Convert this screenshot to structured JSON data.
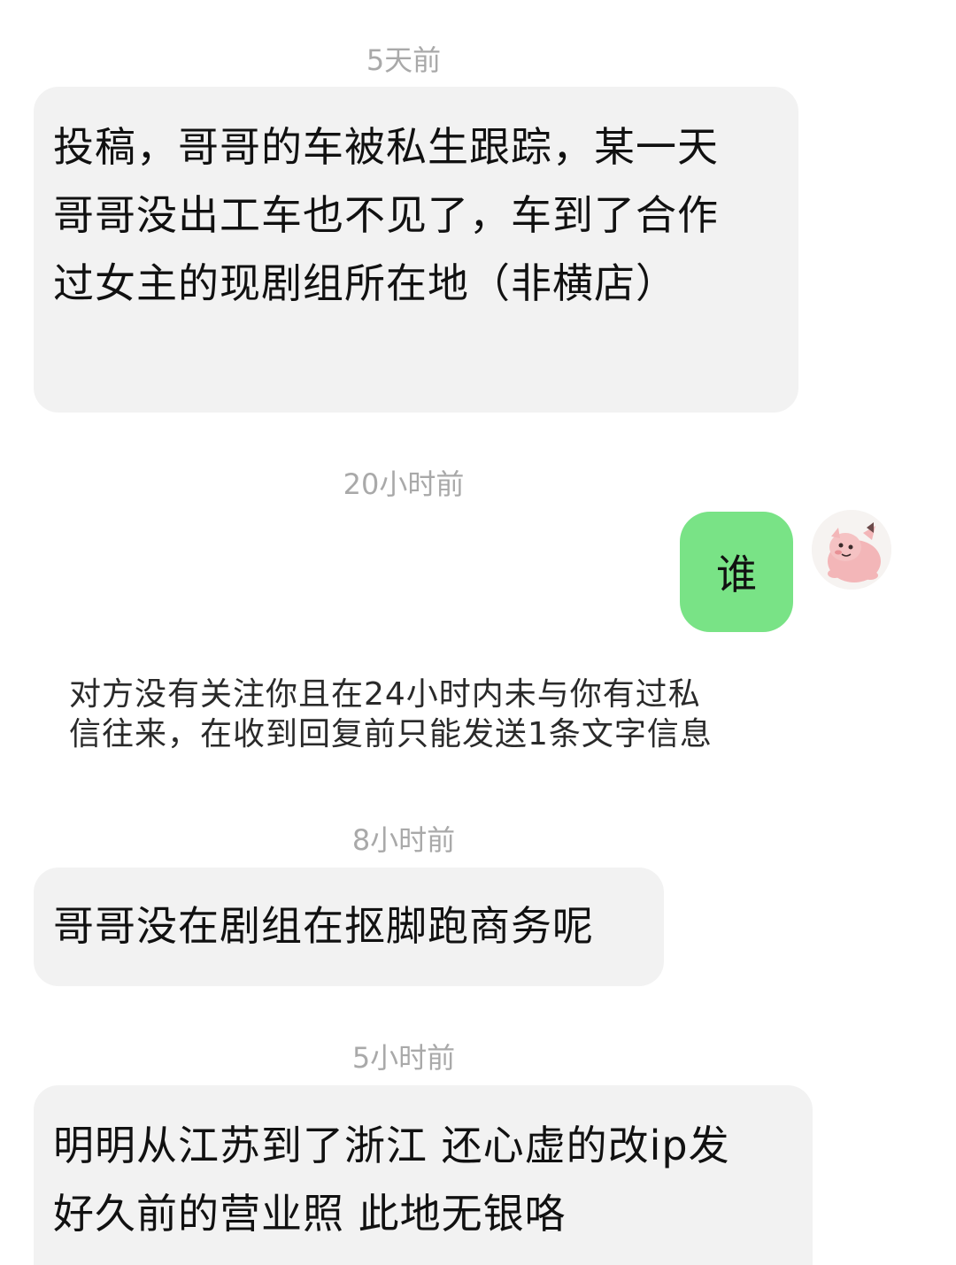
{
  "messages": [
    {
      "timestamp": "5天前",
      "lines": [
        "投稿，哥哥的车被私生跟踪，某一天",
        "哥哥没出工车也不见了，车到了合作",
        "过女主的现剧组所在地（非横店）"
      ]
    },
    {
      "timestamp": "20小时前",
      "outgoing_text": "谁"
    },
    {
      "system_note_lines": [
        "对方没有关注你且在24小时内未与你有过私",
        "信往来，在收到回复前只能发送1条文字信息"
      ]
    },
    {
      "timestamp": "8小时前",
      "lines": [
        "哥哥没在剧组在抠脚跑商务呢"
      ]
    },
    {
      "timestamp": "5小时前",
      "lines": [
        "明明从江苏到了浙江 还心虚的改ip发",
        "好久前的营业照 此地无银咯"
      ]
    }
  ],
  "avatar": {
    "icon": "pink-cartoon-avatar-icon"
  },
  "colors": {
    "incoming_bubble": "#f2f2f2",
    "outgoing_bubble": "#79e386",
    "timestamp_text": "#a9a9a9"
  }
}
